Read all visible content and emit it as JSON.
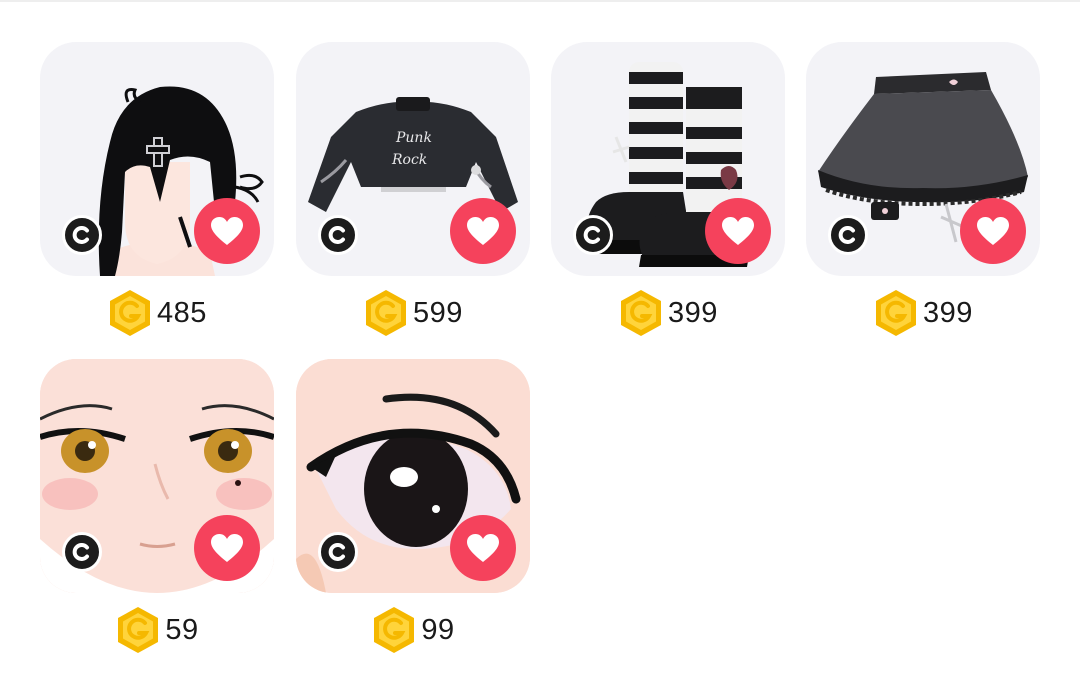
{
  "colors": {
    "favorite": "#f5425c",
    "coin": "#f5b800",
    "creator_badge": "#1c1c1c"
  },
  "items": [
    {
      "kind": "hair",
      "price": "485",
      "badge_icon": "creator-c-icon",
      "favorite_icon": "heart-icon",
      "currency_icon": "gold-coin-icon"
    },
    {
      "kind": "jacket",
      "price": "599",
      "badge_icon": "creator-c-icon",
      "favorite_icon": "heart-icon",
      "currency_icon": "gold-coin-icon"
    },
    {
      "kind": "boots",
      "price": "399",
      "badge_icon": "creator-c-icon",
      "favorite_icon": "heart-icon",
      "currency_icon": "gold-coin-icon"
    },
    {
      "kind": "skirt",
      "price": "399",
      "badge_icon": "creator-c-icon",
      "favorite_icon": "heart-icon",
      "currency_icon": "gold-coin-icon"
    },
    {
      "kind": "face",
      "price": "59",
      "badge_icon": "creator-c-icon",
      "favorite_icon": "heart-icon",
      "currency_icon": "gold-coin-icon"
    },
    {
      "kind": "eye",
      "price": "99",
      "badge_icon": "creator-c-icon",
      "favorite_icon": "heart-icon",
      "currency_icon": "gold-coin-icon"
    }
  ]
}
